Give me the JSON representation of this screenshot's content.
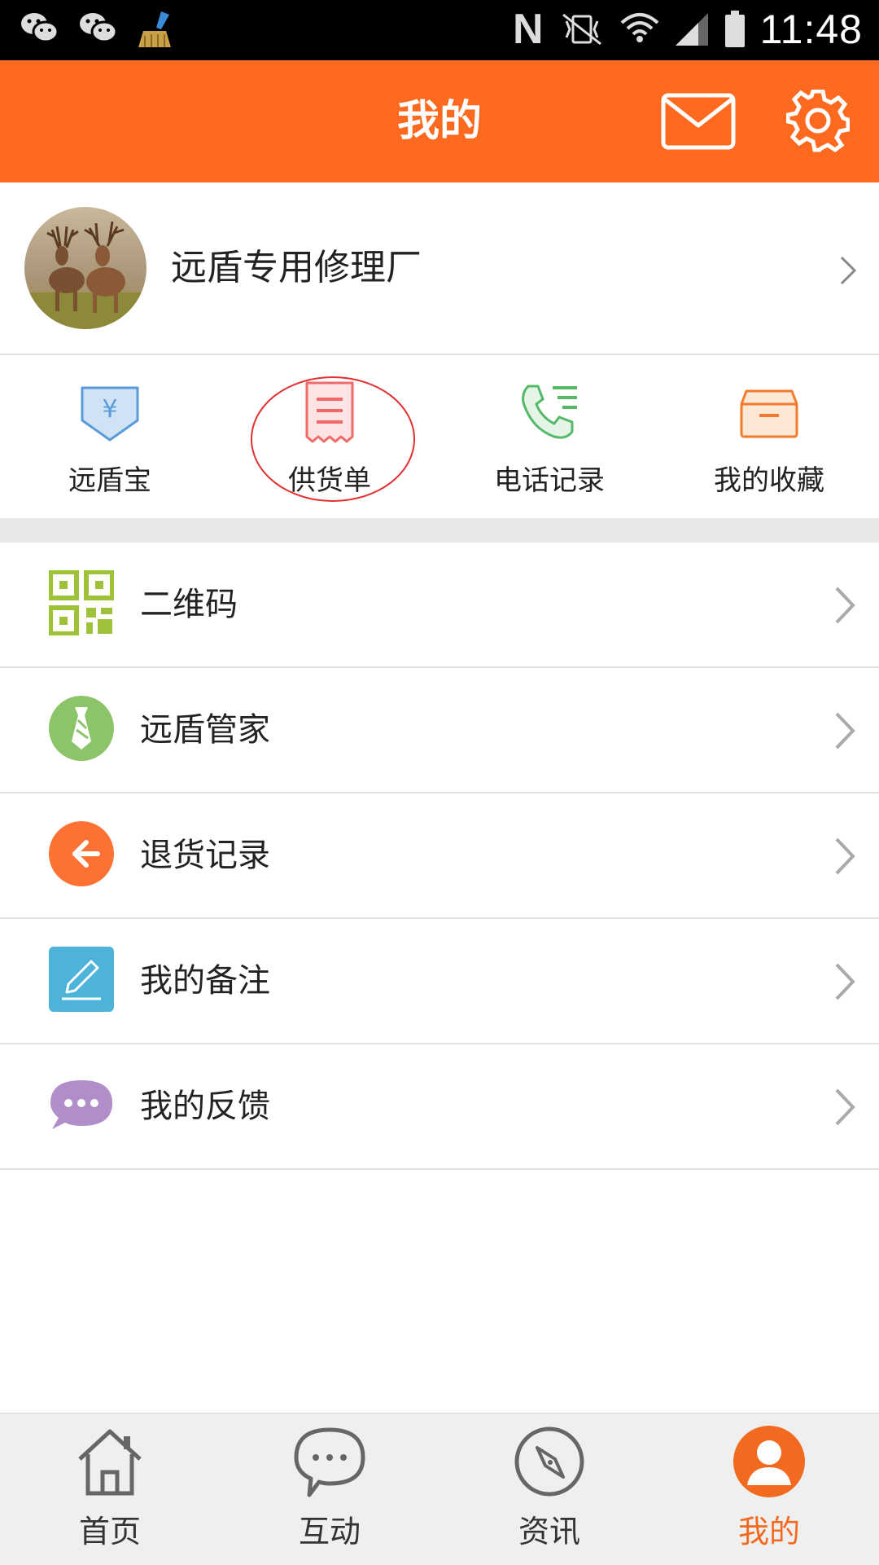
{
  "status_bar": {
    "time": "11:48",
    "nfc_glyph": "N",
    "left_icons": [
      "wechat-icon",
      "wechat-icon",
      "cleaner-broom-icon"
    ],
    "right_icons": [
      "nfc-icon",
      "vibrate-mute-icon",
      "wifi-icon",
      "signal-icon",
      "battery-icon"
    ]
  },
  "header": {
    "title": "我的",
    "accent_color": "#fd6a1f",
    "actions": [
      "mail-icon",
      "settings-gear-icon"
    ]
  },
  "profile": {
    "name": "远盾专用修理厂",
    "avatar": "deer-photo"
  },
  "quick_actions": [
    {
      "label": "远盾宝",
      "icon": "yuan-shield-icon"
    },
    {
      "label": "供货单",
      "icon": "receipt-icon"
    },
    {
      "label": "电话记录",
      "icon": "phone-log-icon"
    },
    {
      "label": "我的收藏",
      "icon": "favorites-box-icon"
    }
  ],
  "menu": [
    {
      "label": "二维码",
      "icon": "qr-code-icon"
    },
    {
      "label": "远盾管家",
      "icon": "tie-butler-icon"
    },
    {
      "label": "退货记录",
      "icon": "return-arrow-icon"
    },
    {
      "label": "我的备注",
      "icon": "edit-note-icon"
    },
    {
      "label": "我的反馈",
      "icon": "feedback-bubble-icon"
    }
  ],
  "bottom_nav": [
    {
      "label": "首页",
      "icon": "home-icon",
      "active": false
    },
    {
      "label": "互动",
      "icon": "chat-bubble-icon",
      "active": false
    },
    {
      "label": "资讯",
      "icon": "compass-icon",
      "active": false
    },
    {
      "label": "我的",
      "icon": "user-icon",
      "active": true
    }
  ]
}
